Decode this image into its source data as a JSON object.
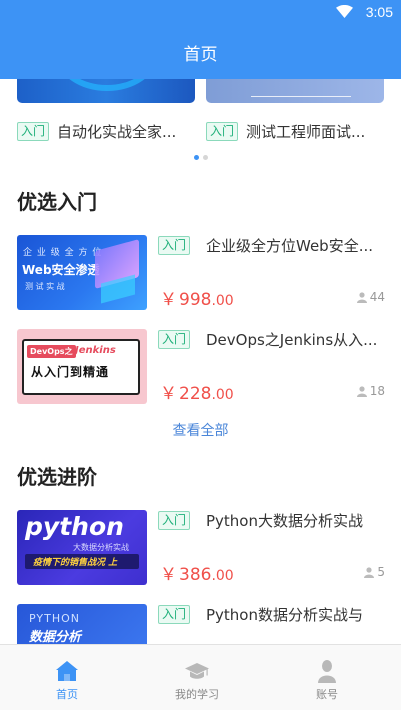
{
  "status_bar": {
    "time": "3:05",
    "wifi_icon": "wifi-icon"
  },
  "header": {
    "title": "首页"
  },
  "carousel": {
    "slides": [
      {
        "badge": "入门",
        "title": "自动化实战全家..."
      },
      {
        "badge": "入门",
        "title": "测试工程师面试..."
      }
    ],
    "active_index": 0,
    "dot_count": 2
  },
  "sections": [
    {
      "title": "优选入门",
      "view_all": "查看全部",
      "courses": [
        {
          "badge": "入门",
          "title": "企业级全方位Web安全...",
          "price_symbol": "￥",
          "price_int": "998",
          "price_dec": ".00",
          "learners": "44",
          "thumb": {
            "line1": "企 业 级 全 方 位",
            "line2": "Web安全渗透",
            "line3": "测 试 实 战"
          }
        },
        {
          "badge": "入门",
          "title": "DevOps之Jenkins从入...",
          "price_symbol": "￥",
          "price_int": "228",
          "price_dec": ".00",
          "learners": "18",
          "thumb": {
            "tag": "DevOps之",
            "sub": "Jenkins",
            "big": "从入门到精通"
          }
        }
      ]
    },
    {
      "title": "优选进阶",
      "courses": [
        {
          "badge": "入门",
          "title": "Python大数据分析实战",
          "price_symbol": "￥",
          "price_int": "386",
          "price_dec": ".00",
          "learners": "5",
          "thumb": {
            "big": "python",
            "sub": "大数据分析实战",
            "band": "疫情下的销售战况 上"
          }
        },
        {
          "badge": "入门",
          "title": "Python数据分析实战与",
          "thumb": {
            "small": "PYTHON",
            "big": "数据分析"
          }
        }
      ]
    }
  ],
  "bottom_nav": [
    {
      "label": "首页",
      "icon": "home-icon",
      "active": true
    },
    {
      "label": "我的学习",
      "icon": "graduation-cap-icon",
      "active": false
    },
    {
      "label": "账号",
      "icon": "user-icon",
      "active": false
    }
  ],
  "colors": {
    "primary": "#3d93f5",
    "price": "#f0504a",
    "badge": "#1fb07a"
  }
}
